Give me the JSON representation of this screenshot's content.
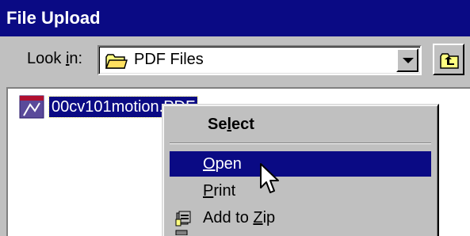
{
  "window": {
    "title": "File Upload"
  },
  "lookin": {
    "label": "Look in:",
    "label_parts": [
      "Look ",
      "i",
      "n:"
    ],
    "folder_icon": "folder-icon",
    "value": "PDF Files",
    "dropdown_icon": "chevron-down-icon",
    "up_button_icon": "up-folder-icon"
  },
  "files": [
    {
      "name": "00cv101motion.PDF",
      "icon": "pdf-file-icon",
      "selected": true
    }
  ],
  "context_menu": {
    "items": [
      {
        "label": "Select",
        "parts": [
          "Se",
          "l",
          "ect"
        ],
        "default": true
      },
      {
        "label": "Open",
        "parts": [
          "",
          "O",
          "pen"
        ],
        "selected": true
      },
      {
        "label": "Print",
        "parts": [
          "",
          "P",
          "rint"
        ]
      },
      {
        "label": "Add to Zip",
        "parts": [
          "Add to ",
          "Z",
          "ip"
        ],
        "icon": "zip-icon"
      }
    ]
  },
  "colors": {
    "title_bar": "#0a0a84",
    "window_bg": "#c0c0c0",
    "selection": "#0a0a84"
  }
}
